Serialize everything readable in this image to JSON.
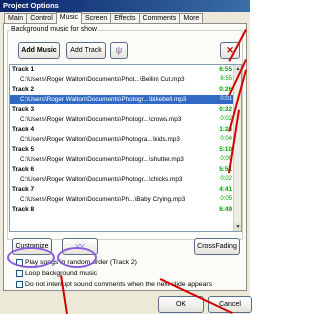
{
  "window": {
    "title": "Project Options"
  },
  "tabs": [
    "Main",
    "Control",
    "Music",
    "Screen",
    "Effects",
    "Comments",
    "More"
  ],
  "group_label": "Background music for show",
  "toolbar": {
    "add_music": "Add Music",
    "add_track": "Add Track"
  },
  "tracks": [
    {
      "title": "Track 1",
      "duration": "6:55",
      "path": "C:\\Users\\Roger Walton\\Documents\\Phot...\\Bellini Cut.mp3",
      "path_time": "6:55",
      "selected": false
    },
    {
      "title": "Track 2",
      "duration": "0:26",
      "path": "C:\\Users\\Roger Walton\\Documents\\Photogr...\\bikebell.mp3",
      "path_time": "0:01",
      "selected": true
    },
    {
      "title": "Track 3",
      "duration": "0:32",
      "path": "C:\\Users\\Roger Walton\\Documents\\Photogr...\\crows.mp3",
      "path_time": "0:02",
      "selected": false
    },
    {
      "title": "Track 4",
      "duration": "1:24",
      "path": "C:\\Users\\Roger Walton\\Documents\\Photogra...\\kids.mp3",
      "path_time": "0:04",
      "selected": false
    },
    {
      "title": "Track 5",
      "duration": "5:10",
      "path": "C:\\Users\\Roger Walton\\Documents\\Photogr...\\shutter.mp3",
      "path_time": "0:00",
      "selected": false
    },
    {
      "title": "Track 6",
      "duration": "5:51",
      "path": "C:\\Users\\Roger Walton\\Documents\\Photogr...\\chicks.mp3",
      "path_time": "0:02",
      "selected": false
    },
    {
      "title": "Track 7",
      "duration": "4:41",
      "path": "C:\\Users\\Roger Walton\\Documents\\Ph...\\Baby Crying.mp3",
      "path_time": "0:05",
      "selected": false
    },
    {
      "title": "Track 8",
      "duration": "6:49",
      "path": "",
      "path_time": "",
      "selected": false
    }
  ],
  "buttons": {
    "customize": "Customize",
    "crossfading": "CrossFading",
    "ok": "OK",
    "cancel": "Cancel"
  },
  "options": [
    {
      "label": "Play songs in random order (Track 2)"
    },
    {
      "label": "Loop background music"
    },
    {
      "label": "Do not interrupt sound comments when the next slide appears"
    }
  ],
  "colors": {
    "duration": "#00a000",
    "selection": "#316ac5",
    "annotation_oval": "#8a5ce0",
    "annotation_arrow": "#d40000"
  }
}
